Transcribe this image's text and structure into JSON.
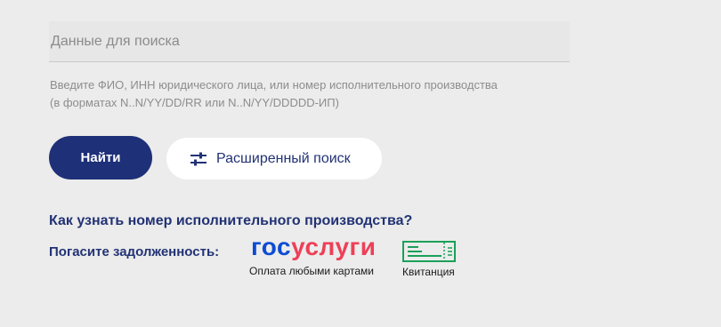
{
  "search": {
    "placeholder": "Данные для поиска",
    "value": ""
  },
  "hint": {
    "line1": "Введите ФИО, ИНН юридического лица, или номер исполнительного производства",
    "line2": "(в форматах N..N/YY/DD/RR или N..N/YY/DDDDD-ИП)"
  },
  "buttons": {
    "find_label": "Найти",
    "advanced_label": "Расширенный поиск"
  },
  "links": {
    "howto": "Как узнать номер исполнительного производства?"
  },
  "payment": {
    "label": "Погасите задолженность:",
    "gosuslugi": {
      "logo_part1": "гос",
      "logo_part2": "услуги",
      "caption": "Оплата любыми картами"
    },
    "receipt": {
      "caption": "Квитанция"
    }
  },
  "colors": {
    "background": "#ebeceb",
    "primary_button": "#1e3078",
    "link_text": "#223275",
    "gosuslugi_blue": "#0d4cd3",
    "gosuslugi_red": "#ee3f58",
    "receipt_green": "#1aa05a"
  },
  "icons": {
    "advanced_search": "sliders-icon",
    "receipt": "receipt-icon"
  }
}
